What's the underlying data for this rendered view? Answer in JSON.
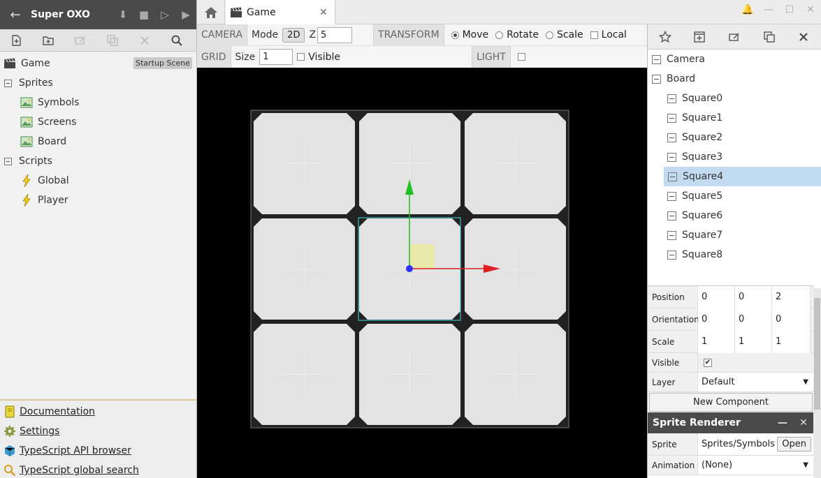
{
  "project": {
    "title": "Super OXO"
  },
  "tree": {
    "items": [
      {
        "label": "Game",
        "badge": "Startup Scene"
      },
      {
        "label": "Sprites"
      },
      {
        "label": "Symbols"
      },
      {
        "label": "Screens"
      },
      {
        "label": "Board"
      },
      {
        "label": "Scripts"
      },
      {
        "label": "Global"
      },
      {
        "label": "Player"
      }
    ]
  },
  "links": {
    "documentation": "Documentation",
    "settings": "Settings",
    "api_browser": "TypeScript API browser",
    "global_search": "TypeScript global search"
  },
  "tabs": {
    "game": "Game"
  },
  "scene_toolbar": {
    "camera_label": "CAMERA",
    "mode_label": "Mode",
    "mode_value": "2D",
    "z_label": "Z",
    "z_value": "5",
    "transform_label": "TRANSFORM",
    "move": "Move",
    "rotate": "Rotate",
    "scale": "Scale",
    "local": "Local",
    "grid_label": "GRID",
    "size_label": "Size",
    "size_value": "1",
    "visible": "Visible",
    "light_label": "LIGHT"
  },
  "actors": {
    "camera": "Camera",
    "board": "Board",
    "squares": [
      "Square0",
      "Square1",
      "Square2",
      "Square3",
      "Square4",
      "Square5",
      "Square6",
      "Square7",
      "Square8"
    ],
    "selected": "Square4"
  },
  "properties": {
    "position_label": "Position",
    "position": [
      "0",
      "0",
      "2"
    ],
    "orientation_label": "Orientation",
    "orientation": [
      "0",
      "0",
      "0"
    ],
    "scale_label": "Scale",
    "scale": [
      "1",
      "1",
      "1"
    ],
    "visible_label": "Visible",
    "visible_checked": true,
    "layer_label": "Layer",
    "layer_value": "Default",
    "new_component": "New Component"
  },
  "sprite_renderer": {
    "title": "Sprite Renderer",
    "sprite_label": "Sprite",
    "sprite_value": "Sprites/Symbols",
    "open_button": "Open",
    "animation_label": "Animation",
    "animation_value": "(None)"
  },
  "colors": {
    "dark_header": "#4a4a4a",
    "selection": "#c2dbf1",
    "gizmo_x": "#e02020",
    "gizmo_y": "#20c020",
    "gizmo_center": "#3030ff",
    "selection_box": "#40e0e0"
  }
}
